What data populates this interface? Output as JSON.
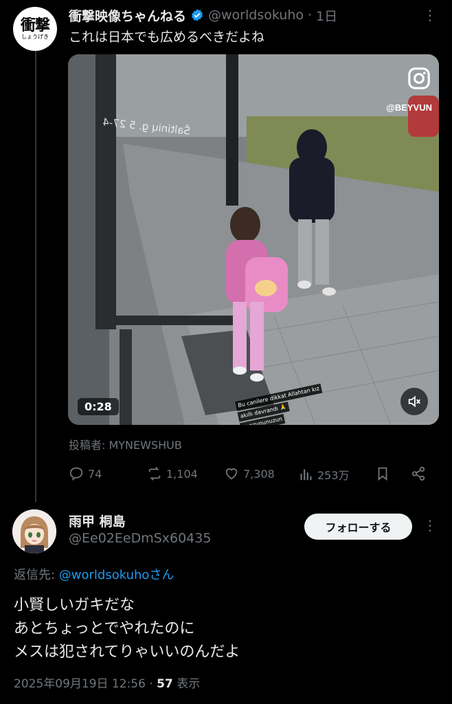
{
  "post1": {
    "avatar_text": "衝撃",
    "avatar_subtext": "しょうげき",
    "author_name": "衝撃映像ちゃんねる",
    "handle": "@worldsokuho",
    "separator": "·",
    "time": "1日",
    "text": "これは日本でも広めるべきだよね",
    "media": {
      "duration": "0:28",
      "watermark": "@BEYVUN",
      "window_text": "Šaltinių g. 5 27-4",
      "story_caption": [
        "Bu canilere dikkat Allahtan kız",
        "akıllı davrandı 🙏",
        "gonzununuzun",
        "..."
      ]
    },
    "source_label": "投稿者: MYNEWSHUB",
    "stats": {
      "replies": "74",
      "reposts": "1,104",
      "likes": "7,308",
      "views": "253万"
    },
    "icons": [
      "reply-icon",
      "repost-icon",
      "like-icon",
      "views-icon",
      "bookmark-icon",
      "share-icon"
    ]
  },
  "post2": {
    "author_name": "雨甲 桐島",
    "handle": "@Ee02EeDmSx60435",
    "follow_label": "フォローする",
    "reply_prefix": "返信先: ",
    "reply_handle": "@worldsokuho",
    "reply_suffix": "さん",
    "lines": [
      "小賢しいガキだな",
      "あとちょっとでやれたのに",
      "メスは犯されてりゃいいのんだよ"
    ],
    "timestamp": "2025年09月19日 12:56",
    "separator": " · ",
    "view_count": "57",
    "view_label": " 表示"
  },
  "colors": {
    "background": "#000000",
    "text": "#e7e9ea",
    "secondary": "#71767b",
    "accent": "#1d9bf0"
  }
}
